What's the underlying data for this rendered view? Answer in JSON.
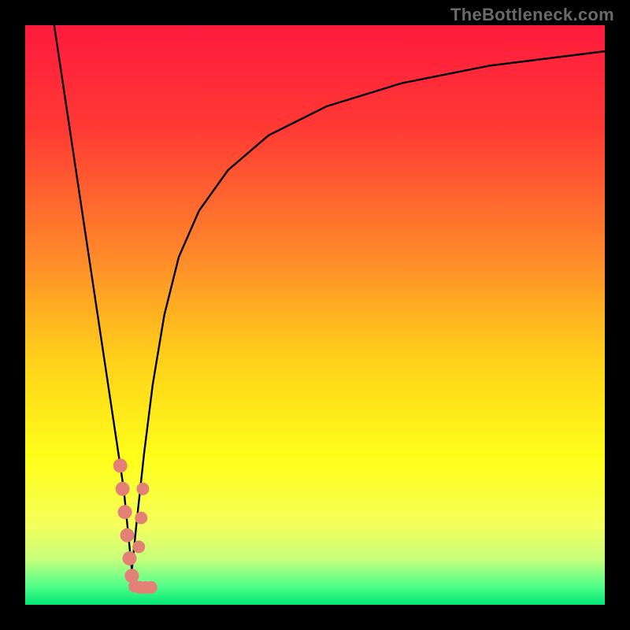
{
  "watermark": "TheBottleneck.com",
  "chart_data": {
    "type": "line",
    "title": "",
    "xlabel": "",
    "ylabel": "",
    "xlim": [
      0,
      100
    ],
    "ylim": [
      0,
      100
    ],
    "gradient_stops": [
      {
        "offset": 0.0,
        "color": "#ff1a3e"
      },
      {
        "offset": 0.18,
        "color": "#ff3a34"
      },
      {
        "offset": 0.4,
        "color": "#ff8a2a"
      },
      {
        "offset": 0.58,
        "color": "#ffd21a"
      },
      {
        "offset": 0.75,
        "color": "#ffff1a"
      },
      {
        "offset": 0.86,
        "color": "#f6ff5a"
      },
      {
        "offset": 0.92,
        "color": "#c8ff7a"
      },
      {
        "offset": 0.965,
        "color": "#5aff8a"
      },
      {
        "offset": 1.0,
        "color": "#00e876"
      }
    ],
    "series": [
      {
        "name": "left-branch",
        "x": [
          5.0,
          6.5,
          8.0,
          9.5,
          11.0,
          12.5,
          14.0,
          15.5,
          17.0,
          17.8,
          18.4
        ],
        "y": [
          100,
          90,
          80,
          70,
          60,
          50,
          40,
          30,
          20,
          12,
          6
        ]
      },
      {
        "name": "right-branch",
        "x": [
          18.4,
          19.2,
          20.5,
          22.0,
          24.0,
          26.5,
          30.0,
          35.0,
          42.0,
          52.0,
          65.0,
          80.0,
          100.0
        ],
        "y": [
          6,
          14,
          26,
          38,
          50,
          60,
          68,
          75,
          81,
          86,
          90,
          93,
          95.5
        ]
      }
    ],
    "markers": {
      "name": "highlight-dots",
      "color": "#e38177",
      "points": [
        {
          "x": 16.4,
          "y": 24,
          "r": 9
        },
        {
          "x": 16.8,
          "y": 20,
          "r": 9
        },
        {
          "x": 17.2,
          "y": 16,
          "r": 9
        },
        {
          "x": 17.6,
          "y": 12,
          "r": 9
        },
        {
          "x": 18.0,
          "y": 8,
          "r": 9
        },
        {
          "x": 18.4,
          "y": 5,
          "r": 9
        },
        {
          "x": 18.9,
          "y": 3.2,
          "r": 8
        },
        {
          "x": 19.8,
          "y": 3.0,
          "r": 8
        },
        {
          "x": 20.8,
          "y": 3.0,
          "r": 8
        },
        {
          "x": 21.7,
          "y": 3.0,
          "r": 8
        },
        {
          "x": 20.3,
          "y": 20,
          "r": 8
        },
        {
          "x": 20.0,
          "y": 15,
          "r": 8
        },
        {
          "x": 19.6,
          "y": 10,
          "r": 8
        }
      ]
    }
  }
}
